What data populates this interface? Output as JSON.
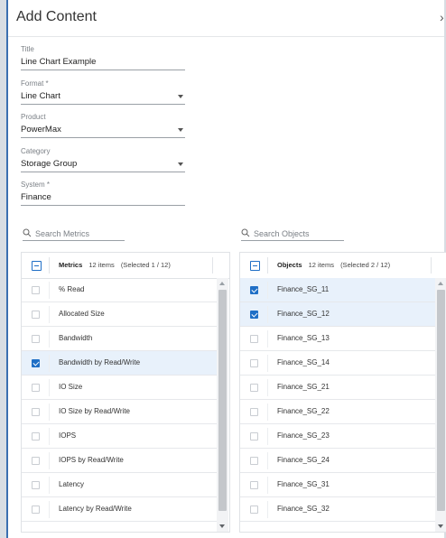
{
  "dialog": {
    "title": "Add Content",
    "close_icon": "close-icon"
  },
  "form": {
    "title": {
      "label": "Title",
      "value": "Line Chart Example"
    },
    "format": {
      "label": "Format *",
      "value": "Line Chart"
    },
    "product": {
      "label": "Product",
      "value": "PowerMax"
    },
    "category": {
      "label": "Category",
      "value": "Storage Group"
    },
    "system": {
      "label": "System *",
      "value": "Finance"
    }
  },
  "metrics": {
    "search_placeholder": "Search Metrics",
    "header_title": "Metrics",
    "header_count": "12 items",
    "header_selected": "(Selected 1 / 12)",
    "items": [
      {
        "label": "% Read",
        "selected": false
      },
      {
        "label": "Allocated Size",
        "selected": false
      },
      {
        "label": "Bandwidth",
        "selected": false
      },
      {
        "label": "Bandwidth by Read/Write",
        "selected": true
      },
      {
        "label": "IO Size",
        "selected": false
      },
      {
        "label": "IO Size by Read/Write",
        "selected": false
      },
      {
        "label": "IOPS",
        "selected": false
      },
      {
        "label": "IOPS by Read/Write",
        "selected": false
      },
      {
        "label": "Latency",
        "selected": false
      },
      {
        "label": "Latency by Read/Write",
        "selected": false
      }
    ]
  },
  "objects": {
    "search_placeholder": "Search Objects",
    "header_title": "Objects",
    "header_count": "12 items",
    "header_selected": "(Selected 2 / 12)",
    "items": [
      {
        "label": "Finance_SG_11",
        "selected": true
      },
      {
        "label": "Finance_SG_12",
        "selected": true
      },
      {
        "label": "Finance_SG_13",
        "selected": false
      },
      {
        "label": "Finance_SG_14",
        "selected": false
      },
      {
        "label": "Finance_SG_21",
        "selected": false
      },
      {
        "label": "Finance_SG_22",
        "selected": false
      },
      {
        "label": "Finance_SG_23",
        "selected": false
      },
      {
        "label": "Finance_SG_24",
        "selected": false
      },
      {
        "label": "Finance_SG_31",
        "selected": false
      },
      {
        "label": "Finance_SG_32",
        "selected": false
      }
    ]
  },
  "colors": {
    "accent": "#1f6fc6",
    "selected_row": "#e8f1fb",
    "frame": "#3a6fb0"
  }
}
